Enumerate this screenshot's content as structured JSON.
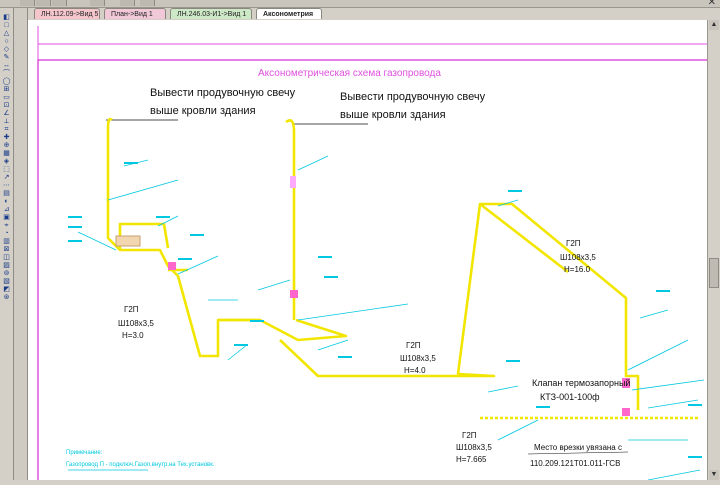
{
  "tabs": [
    {
      "label": "ЛН.112.09->Вид 5",
      "color": "#f4c6cc"
    },
    {
      "label": "План->Вид 1",
      "color": "#f0c8d8"
    },
    {
      "label": "ЛН.246.03-И1->Вид 1",
      "color": "#cde8c6"
    },
    {
      "label": "Аксонометрия",
      "color": "#ffffff"
    }
  ],
  "drawing": {
    "title": "Аксонометрическая схема газопровода",
    "note1_line1": "Вывести продувочную свечу",
    "note1_line2": "выше кровли здания",
    "note2_line1": "Вывести продувочную свечу",
    "note2_line2": "выше кровли здания",
    "pipe1_name": "Г2П",
    "pipe1_size": "Ш108х3,5",
    "pipe1_height": "H=3.0",
    "pipe2_name": "Г2П",
    "pipe2_size": "Ш108х3,5",
    "pipe2_height": "H=4.0",
    "pipe3_name": "Г2П",
    "pipe3_size": "Ш108х3,5",
    "pipe3_height": "H=16.0",
    "pipe4_name": "Г2П",
    "pipe4_size": "Ш108х3,5",
    "pipe4_height": "H=7.665",
    "valve_line1": "Клапан термозапорный",
    "valve_line2": "КТЗ-001-100ф",
    "tiein_line1": "Место врезки увязана с",
    "tiein_line2": "110.209.121Т01.011-ГСВ",
    "footnote_line1": "Примечание:",
    "footnote_line2": "Газопровод П - подключ.Газоп.внутр.на Тех.установк."
  },
  "colors": {
    "pipe": "#f2e600",
    "frame": "#e050e0",
    "dimension": "#00c8e0",
    "text": "#111111",
    "fitting": "#b0b0ff"
  }
}
